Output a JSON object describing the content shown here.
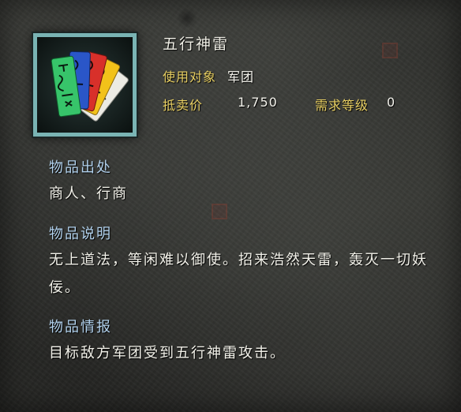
{
  "item": {
    "name": "五行神雷",
    "icon": "five-color-talisman-cards-icon"
  },
  "attributes": {
    "target_label": "使用对象",
    "target_value": "军团",
    "price_label": "抵卖价",
    "price_value": "1,750",
    "level_label": "需求等级",
    "level_value": "0"
  },
  "sections": {
    "source": {
      "heading": "物品出处",
      "text": "商人、行商"
    },
    "description": {
      "heading": "物品说明",
      "text": "无上道法，等闲难以御使。招来浩然天雷，轰灭一切妖佞。"
    },
    "intel": {
      "heading": "物品情报",
      "text": "目标敌方军团受到五行神雷攻击。"
    }
  },
  "colors": {
    "label": "#e8cf62",
    "heading": "#b2d2ee",
    "text": "#f3f2ea",
    "frame": "#7ab4b4"
  }
}
